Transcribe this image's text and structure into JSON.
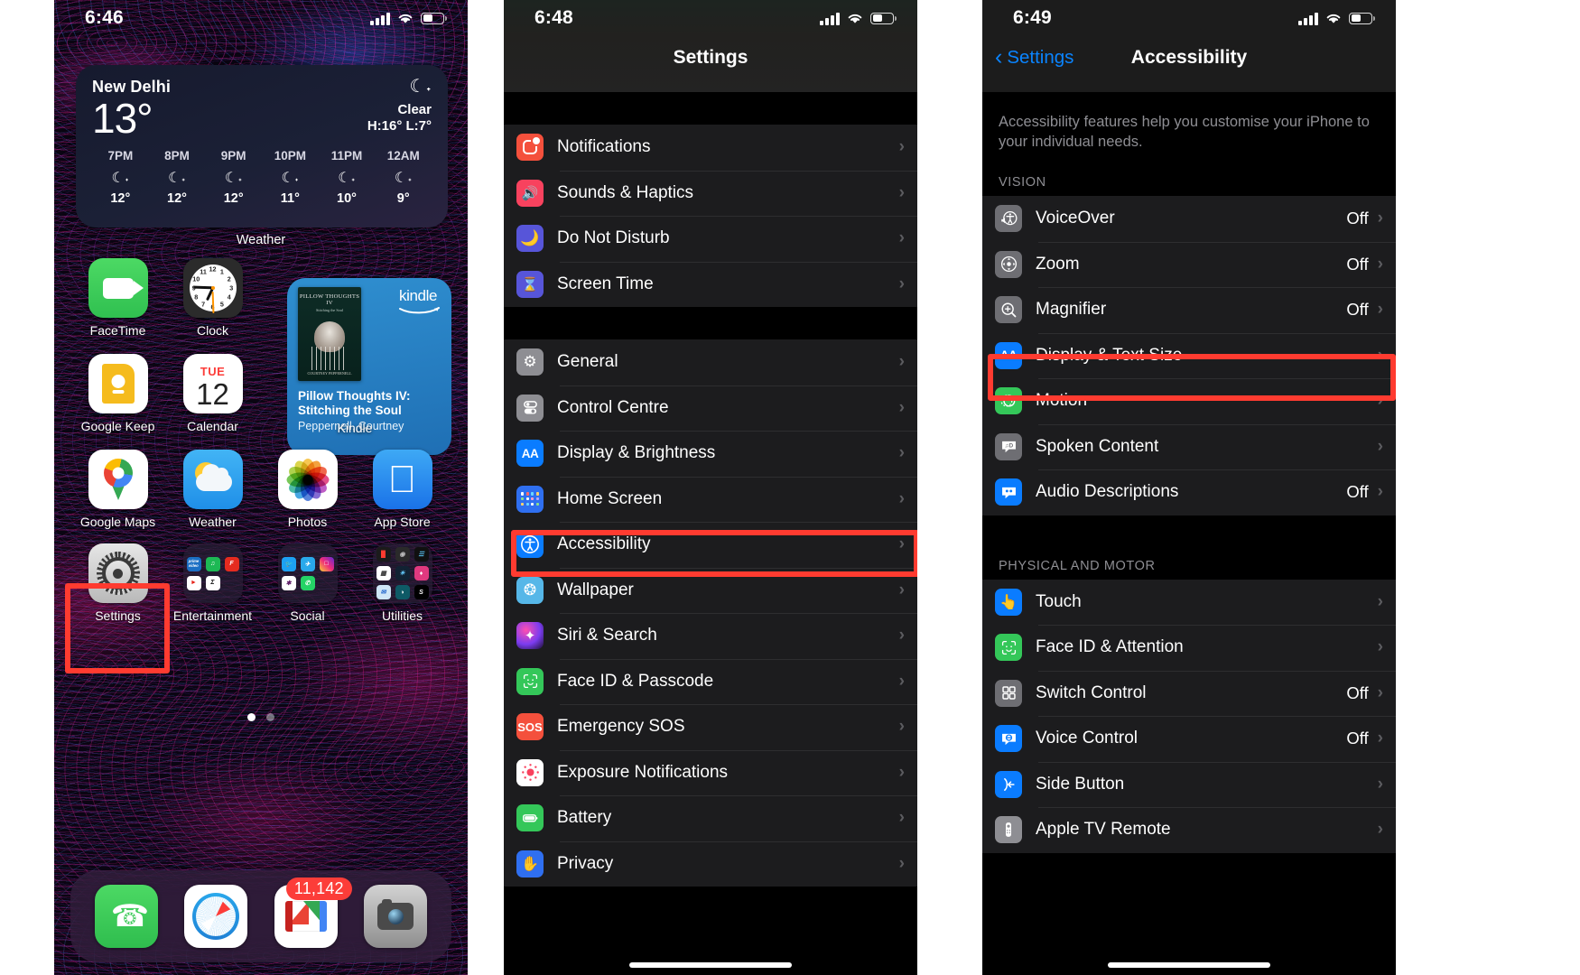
{
  "home_screen": {
    "status": {
      "time": "6:46"
    },
    "weather_widget": {
      "city": "New Delhi",
      "temperature": "13°",
      "condition": "Clear",
      "high_low": "H:16° L:7°",
      "condition_icon": "moon-stars-icon",
      "hourly": [
        {
          "hour": "7PM",
          "icon": "moon-stars-icon",
          "temp": "12°"
        },
        {
          "hour": "8PM",
          "icon": "moon-stars-icon",
          "temp": "12°"
        },
        {
          "hour": "9PM",
          "icon": "moon-stars-icon",
          "temp": "12°"
        },
        {
          "hour": "10PM",
          "icon": "moon-stars-icon",
          "temp": "11°"
        },
        {
          "hour": "11PM",
          "icon": "moon-stars-icon",
          "temp": "10°"
        },
        {
          "hour": "12AM",
          "icon": "moon-stars-icon",
          "temp": "9°"
        }
      ],
      "widget_label": "Weather"
    },
    "kindle_widget": {
      "brand": "kindle",
      "title": "Pillow Thoughts IV: Stitching the Soul",
      "author": "Peppernell, Courtney",
      "label": "Kindle",
      "cover_title": "PILLOW THOUGHTS IV",
      "cover_subtitle": "Stitching the Soul",
      "cover_author": "COURTNEY PEPPERNELL"
    },
    "apps": [
      {
        "label": "FaceTime",
        "icon": "facetime-icon"
      },
      {
        "label": "Clock",
        "icon": "clock-icon"
      },
      {
        "label": "Google Keep",
        "icon": "google-keep-icon"
      },
      {
        "label": "Calendar",
        "icon": "calendar-icon",
        "day_name": "TUE",
        "day_number": "12"
      },
      {
        "label": "Google Maps",
        "icon": "google-maps-icon"
      },
      {
        "label": "Weather",
        "icon": "weather-icon"
      },
      {
        "label": "Photos",
        "icon": "photos-icon"
      },
      {
        "label": "App Store",
        "icon": "app-store-icon"
      },
      {
        "label": "Settings",
        "icon": "settings-gear-icon"
      },
      {
        "label": "Entertainment",
        "icon": "folder-icon"
      },
      {
        "label": "Social",
        "icon": "folder-icon"
      },
      {
        "label": "Utilities",
        "icon": "folder-icon"
      }
    ],
    "page_dots": {
      "count": 2,
      "active": 1
    },
    "dock": [
      {
        "label": "Phone",
        "icon": "phone-icon"
      },
      {
        "label": "Safari",
        "icon": "safari-compass-icon"
      },
      {
        "label": "Gmail",
        "icon": "gmail-envelope-icon",
        "badge": "11,142"
      },
      {
        "label": "Camera",
        "icon": "camera-icon"
      }
    ],
    "highlight": {
      "target": "Settings",
      "color": "#ff3b30"
    }
  },
  "settings_screen": {
    "status": {
      "time": "6:48"
    },
    "title": "Settings",
    "group_1": [
      {
        "label": "Notifications",
        "icon": "notifications-icon",
        "chevron": "›"
      },
      {
        "label": "Sounds & Haptics",
        "icon": "sounds-haptics-icon",
        "chevron": "›"
      },
      {
        "label": "Do Not Disturb",
        "icon": "do-not-disturb-moon-icon",
        "chevron": "›"
      },
      {
        "label": "Screen Time",
        "icon": "screen-time-hourglass-icon",
        "chevron": "›"
      }
    ],
    "group_2": [
      {
        "label": "General",
        "icon": "general-gear-icon",
        "chevron": "›"
      },
      {
        "label": "Control Centre",
        "icon": "control-centre-icon",
        "chevron": "›"
      },
      {
        "label": "Display & Brightness",
        "icon": "display-brightness-aa-icon",
        "chevron": "›"
      },
      {
        "label": "Home Screen",
        "icon": "home-screen-icon",
        "chevron": "›"
      },
      {
        "label": "Accessibility",
        "icon": "accessibility-icon",
        "chevron": "›",
        "highlighted": true
      },
      {
        "label": "Wallpaper",
        "icon": "wallpaper-icon",
        "chevron": "›"
      },
      {
        "label": "Siri & Search",
        "icon": "siri-icon",
        "chevron": "›"
      },
      {
        "label": "Face ID & Passcode",
        "icon": "face-id-icon",
        "chevron": "›"
      },
      {
        "label": "Emergency SOS",
        "icon": "emergency-sos-icon",
        "chevron": "›"
      },
      {
        "label": "Exposure Notifications",
        "icon": "exposure-notifications-icon",
        "chevron": "›"
      },
      {
        "label": "Battery",
        "icon": "battery-icon",
        "chevron": "›"
      },
      {
        "label": "Privacy",
        "icon": "privacy-hand-icon",
        "chevron": "›"
      }
    ],
    "highlight": {
      "target": "Accessibility",
      "color": "#ff3b30"
    }
  },
  "accessibility_screen": {
    "status": {
      "time": "6:49"
    },
    "back_label": "Settings",
    "title": "Accessibility",
    "intro": "Accessibility features help you customise your iPhone to your individual needs.",
    "sections": [
      {
        "header": "VISION",
        "items": [
          {
            "label": "VoiceOver",
            "icon": "voiceover-icon",
            "value": "Off",
            "chevron": "›"
          },
          {
            "label": "Zoom",
            "icon": "zoom-icon",
            "value": "Off",
            "chevron": "›"
          },
          {
            "label": "Magnifier",
            "icon": "magnifier-icon",
            "value": "Off",
            "chevron": "›"
          },
          {
            "label": "Display & Text Size",
            "icon": "display-text-size-aa-icon",
            "value": "",
            "chevron": "›",
            "highlighted": true
          },
          {
            "label": "Motion",
            "icon": "motion-icon",
            "value": "",
            "chevron": "›"
          },
          {
            "label": "Spoken Content",
            "icon": "spoken-content-icon",
            "value": "",
            "chevron": "›"
          },
          {
            "label": "Audio Descriptions",
            "icon": "audio-descriptions-icon",
            "value": "Off",
            "chevron": "›"
          }
        ]
      },
      {
        "header": "PHYSICAL AND MOTOR",
        "items": [
          {
            "label": "Touch",
            "icon": "touch-icon",
            "value": "",
            "chevron": "›"
          },
          {
            "label": "Face ID & Attention",
            "icon": "face-id-attention-icon",
            "value": "",
            "chevron": "›"
          },
          {
            "label": "Switch Control",
            "icon": "switch-control-icon",
            "value": "Off",
            "chevron": "›"
          },
          {
            "label": "Voice Control",
            "icon": "voice-control-icon",
            "value": "Off",
            "chevron": "›"
          },
          {
            "label": "Side Button",
            "icon": "side-button-icon",
            "value": "",
            "chevron": "›"
          },
          {
            "label": "Apple TV Remote",
            "icon": "apple-tv-remote-icon",
            "value": "",
            "chevron": "›"
          }
        ]
      }
    ],
    "highlight": {
      "target": "Display & Text Size",
      "color": "#ff3b30"
    }
  }
}
